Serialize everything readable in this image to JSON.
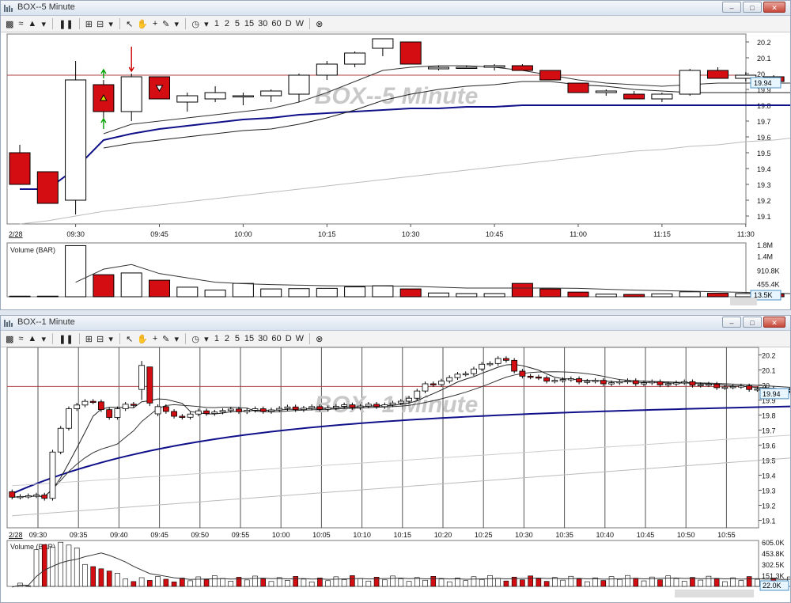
{
  "windows": [
    {
      "id": "top",
      "title": "BOX--5 Minute",
      "toolbar": {
        "intervals": [
          "1",
          "2",
          "5",
          "15",
          "30",
          "60",
          "D",
          "W"
        ]
      },
      "chart_data": {
        "type": "candlestick",
        "watermark": "BOX--5 Minute",
        "date_label": "2/28",
        "x_ticks": [
          "09:30",
          "09:45",
          "10:00",
          "10:15",
          "10:30",
          "10:45",
          "11:00",
          "11:15",
          "11:30"
        ],
        "y_ticks": [
          "20.2",
          "20.1",
          "20",
          "19.9",
          "19.8",
          "19.7",
          "19.6",
          "19.5",
          "19.4",
          "19.3",
          "19.2",
          "19.1"
        ],
        "ylim": [
          19.05,
          20.25
        ],
        "last_price": "19.94",
        "ref_line": 19.99,
        "candles": [
          {
            "o": 19.5,
            "h": 19.55,
            "l": 19.3,
            "c": 19.3
          },
          {
            "o": 19.38,
            "h": 19.38,
            "l": 19.18,
            "c": 19.18
          },
          {
            "o": 19.2,
            "h": 20.08,
            "l": 19.11,
            "c": 19.96
          },
          {
            "o": 19.93,
            "h": 19.96,
            "l": 19.72,
            "c": 19.76
          },
          {
            "o": 19.76,
            "h": 20.0,
            "l": 19.7,
            "c": 19.98
          },
          {
            "o": 19.98,
            "h": 19.98,
            "l": 19.84,
            "c": 19.84
          },
          {
            "o": 19.82,
            "h": 19.88,
            "l": 19.76,
            "c": 19.86
          },
          {
            "o": 19.84,
            "h": 19.92,
            "l": 19.82,
            "c": 19.88
          },
          {
            "o": 19.86,
            "h": 19.88,
            "l": 19.8,
            "c": 19.86
          },
          {
            "o": 19.86,
            "h": 19.9,
            "l": 19.82,
            "c": 19.89
          },
          {
            "o": 19.87,
            "h": 20.0,
            "l": 19.82,
            "c": 19.99
          },
          {
            "o": 19.99,
            "h": 20.08,
            "l": 19.96,
            "c": 20.06
          },
          {
            "o": 20.06,
            "h": 20.14,
            "l": 20.04,
            "c": 20.13
          },
          {
            "o": 20.16,
            "h": 20.2,
            "l": 20.11,
            "c": 20.22
          },
          {
            "o": 20.2,
            "h": 20.2,
            "l": 20.06,
            "c": 20.06
          },
          {
            "o": 20.03,
            "h": 20.05,
            "l": 20.02,
            "c": 20.04
          },
          {
            "o": 20.04,
            "h": 20.05,
            "l": 20.03,
            "c": 20.04
          },
          {
            "o": 20.04,
            "h": 20.06,
            "l": 20.02,
            "c": 20.05
          },
          {
            "o": 20.05,
            "h": 20.06,
            "l": 20.02,
            "c": 20.02
          },
          {
            "o": 20.02,
            "h": 20.02,
            "l": 19.96,
            "c": 19.96
          },
          {
            "o": 19.94,
            "h": 19.94,
            "l": 19.88,
            "c": 19.88
          },
          {
            "o": 19.88,
            "h": 19.9,
            "l": 19.86,
            "c": 19.89
          },
          {
            "o": 19.87,
            "h": 19.89,
            "l": 19.84,
            "c": 19.84
          },
          {
            "o": 19.84,
            "h": 19.88,
            "l": 19.82,
            "c": 19.87
          },
          {
            "o": 19.87,
            "h": 20.03,
            "l": 19.86,
            "c": 20.02
          },
          {
            "o": 20.02,
            "h": 20.04,
            "l": 19.97,
            "c": 19.97
          },
          {
            "o": 19.97,
            "h": 20.01,
            "l": 19.95,
            "c": 19.99
          },
          {
            "o": 19.98,
            "h": 19.99,
            "l": 19.95,
            "c": 19.95
          },
          {
            "o": 19.95,
            "h": 19.97,
            "l": 19.94,
            "c": 19.96
          }
        ],
        "series": [
          {
            "name": "",
            "color": "#10108a",
            "width": 2,
            "values": [
              19.27,
              19.27,
              19.4,
              19.58,
              19.62,
              19.65,
              19.67,
              19.69,
              19.71,
              19.72,
              19.74,
              19.75,
              19.76,
              19.77,
              19.78,
              19.78,
              19.79,
              19.79,
              19.8,
              19.8,
              19.8,
              19.8,
              19.8,
              19.8,
              19.8,
              19.8,
              19.8,
              19.8,
              19.8
            ]
          },
          {
            "name": "",
            "color": "#222222",
            "width": 1,
            "values": [
              null,
              null,
              null,
              19.53,
              19.56,
              19.58,
              19.6,
              19.62,
              19.64,
              19.65,
              19.68,
              19.72,
              19.77,
              19.83,
              19.87,
              19.9,
              19.92,
              19.93,
              19.95,
              19.95,
              19.93,
              19.92,
              19.9,
              19.89,
              19.88,
              19.88,
              19.88,
              19.88,
              19.88
            ]
          },
          {
            "name": "",
            "color": "#333333",
            "width": 1,
            "values": [
              null,
              null,
              null,
              19.62,
              19.68,
              19.7,
              19.72,
              19.74,
              19.76,
              19.78,
              19.82,
              19.88,
              19.95,
              20.02,
              20.04,
              20.05,
              20.05,
              20.04,
              20.02,
              19.99,
              19.96,
              19.94,
              19.93,
              19.92,
              19.93,
              19.94,
              19.94,
              19.94,
              19.94
            ]
          },
          {
            "name": "",
            "color": "#bbbbbb",
            "width": 1,
            "values": [
              19.05,
              19.07,
              19.1,
              19.13,
              19.15,
              19.17,
              19.19,
              19.21,
              19.23,
              19.25,
              19.27,
              19.29,
              19.31,
              19.33,
              19.35,
              19.37,
              19.39,
              19.41,
              19.43,
              19.45,
              19.47,
              19.49,
              19.51,
              19.52,
              19.54,
              19.55,
              19.57,
              19.58,
              19.6
            ]
          }
        ],
        "markers": [
          {
            "idx": 3,
            "kind": "triangle-up",
            "color": "#d8d800"
          },
          {
            "idx": 5,
            "kind": "triangle-down",
            "color": "#ffffff"
          },
          {
            "idx": 4,
            "kind": "arrow-down",
            "color": "#cc0000"
          },
          {
            "idx": 3,
            "kind": "arrow-up",
            "color": "#00a000"
          }
        ],
        "volume": {
          "label": "Volume (BAR)",
          "y_ticks": [
            "1.8M",
            "1.4M",
            "910.8K",
            "455.4K"
          ],
          "last": "13.5K",
          "ymax": 1800,
          "values": [
            20,
            20,
            1760,
            760,
            820,
            570,
            330,
            230,
            460,
            270,
            280,
            290,
            340,
            380,
            270,
            130,
            110,
            110,
            460,
            270,
            160,
            90,
            80,
            100,
            170,
            120,
            110,
            90,
            70
          ],
          "ma": [
            null,
            null,
            500,
            950,
            1110,
            800,
            650,
            500,
            450,
            420,
            400,
            380,
            370,
            370,
            360,
            330,
            300,
            300,
            300,
            300,
            290,
            260,
            230,
            210,
            190,
            170,
            150,
            120,
            100
          ]
        }
      }
    },
    {
      "id": "bottom",
      "title": "BOX--1 Minute",
      "toolbar": {
        "intervals": [
          "1",
          "2",
          "5",
          "15",
          "30",
          "60",
          "D",
          "W"
        ]
      },
      "chart_data": {
        "type": "candlestick",
        "watermark": "BOX--1 Minute",
        "date_label": "2/28",
        "x_ticks": [
          "09:30",
          "09:35",
          "09:40",
          "09:45",
          "09:50",
          "09:55",
          "10:00",
          "10:05",
          "10:10",
          "10:15",
          "10:20",
          "10:25",
          "10:30",
          "10:35",
          "10:40",
          "10:45",
          "10:50",
          "10:55"
        ],
        "y_ticks": [
          "20.2",
          "20.1",
          "20",
          "19.9",
          "19.8",
          "19.7",
          "19.6",
          "19.5",
          "19.4",
          "19.3",
          "19.2",
          "19.1"
        ],
        "ylim": [
          19.05,
          20.25
        ],
        "last_price": "19.94",
        "ref_line": 19.99,
        "volume": {
          "label": "Volume (BAR)",
          "y_ticks": [
            "605.0K",
            "453.8K",
            "302.5K",
            "151.3K"
          ],
          "last": "22.0K",
          "ymax": 605
        }
      }
    }
  ],
  "colors": {
    "down": "#d40d12",
    "up": "#ffffff",
    "grid": "#555555",
    "ref": "#b04040",
    "watermark": "#c8c8c8"
  }
}
